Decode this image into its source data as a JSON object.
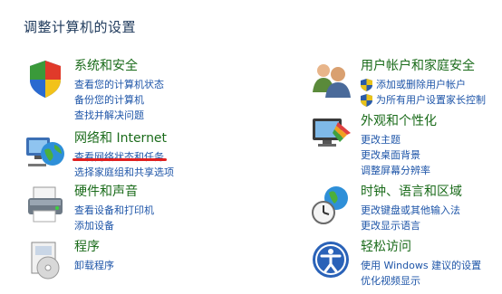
{
  "page_title": "调整计算机的设置",
  "left": [
    {
      "title": "系统和安全",
      "links": [
        "查看您的计算机状态",
        "备份您的计算机",
        "查找并解决问题"
      ],
      "icon": "shield-flag-icon"
    },
    {
      "title": "网络和 Internet",
      "links": [
        "查看网络状态和任务",
        "选择家庭组和共享选项"
      ],
      "icon": "network-globe-icon"
    },
    {
      "title": "硬件和声音",
      "links": [
        "查看设备和打印机",
        "添加设备"
      ],
      "icon": "printer-icon"
    },
    {
      "title": "程序",
      "links": [
        "卸载程序"
      ],
      "icon": "programs-icon"
    }
  ],
  "right": [
    {
      "title": "用户帐户和家庭安全",
      "links": [
        "添加或删除用户帐户",
        "为所有用户设置家长控制"
      ],
      "icon": "users-icon"
    },
    {
      "title": "外观和个性化",
      "links": [
        "更改主题",
        "更改桌面背景",
        "调整屏幕分辨率"
      ],
      "icon": "monitor-palette-icon"
    },
    {
      "title": "时钟、语言和区域",
      "links": [
        "更改键盘或其他输入法",
        "更改显示语言"
      ],
      "icon": "clock-globe-icon"
    },
    {
      "title": "轻松访问",
      "links": [
        "使用 Windows 建议的设置",
        "优化视频显示"
      ],
      "icon": "ease-of-access-icon"
    }
  ],
  "colors": {
    "title_green": "#1a6b1a",
    "link_blue": "#1e55a8",
    "annotation_red": "#e02020"
  }
}
